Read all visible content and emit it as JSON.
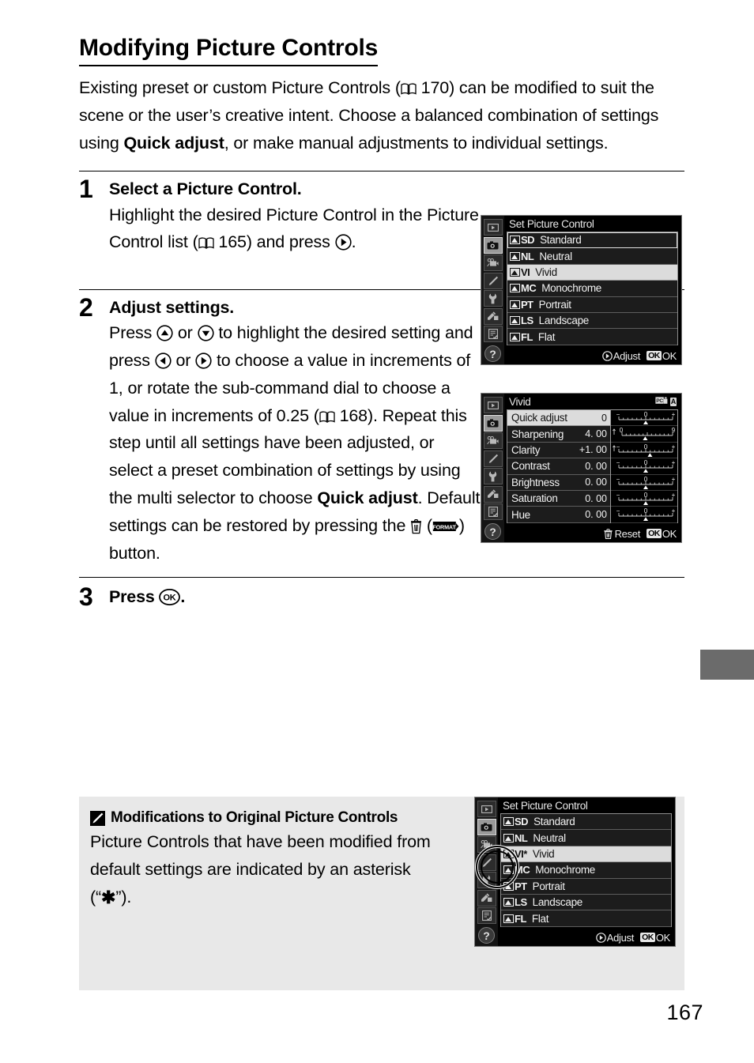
{
  "page": {
    "number": "167"
  },
  "heading": {
    "title": "Modifying Picture Controls"
  },
  "intro": {
    "p1_a": "Existing preset or custom Picture Controls (",
    "p1_ref": "170",
    "p1_b": ") can be modified to suit the scene or the user’s creative intent.  Choose a balanced combination of settings using ",
    "p1_bold": "Quick adjust",
    "p1_c": ", or make manual adjustments to individual settings."
  },
  "steps": [
    {
      "num": "1",
      "head": "Select a Picture Control.",
      "body_a": "Highlight the desired Picture Control in the Picture Control list (",
      "ref": "165",
      "body_b": ") and press ",
      "body_c": "."
    },
    {
      "num": "2",
      "head": "Adjust settings.",
      "body_a": "Press ",
      "body_b": " or ",
      "body_c": " to highlight the desired setting and press ",
      "body_d": " or ",
      "body_e": " to choose a value in increments of 1, or rotate the sub-command dial to choose a value in increments of 0.25 (",
      "ref": "168",
      "body_f": ").  Repeat this step until all settings have been adjusted, or select a preset combination of settings by using the multi selector to choose ",
      "bold": "Quick adjust",
      "body_g": ".  Default settings can be restored by pressing the ",
      "body_h": " (",
      "body_i": ") button."
    },
    {
      "num": "3",
      "head_a": "Press ",
      "head_b": "."
    }
  ],
  "note": {
    "icon": "pencil-icon",
    "title": "Modifications to Original Picture Controls",
    "body_a": "Picture Controls that have been modified from default settings are indicated by an asterisk (“",
    "asterisk": "✱",
    "body_b": "”)."
  },
  "lcd_rail": {
    "icons": [
      {
        "name": "playback-icon",
        "active": false
      },
      {
        "name": "photo-shooting-menu-icon",
        "active": true
      },
      {
        "name": "movie-shooting-menu-icon",
        "active": false
      },
      {
        "name": "custom-settings-pencil-icon",
        "active": false
      },
      {
        "name": "setup-wrench-icon",
        "active": false
      },
      {
        "name": "retouch-brush-icon",
        "active": false
      },
      {
        "name": "my-menu-icon",
        "active": false
      }
    ],
    "help_label": "?"
  },
  "screen1": {
    "title": "Set Picture Control",
    "rows": [
      {
        "code": "SD",
        "label": "Standard",
        "state": "cursor"
      },
      {
        "code": "NL",
        "label": "Neutral",
        "state": "normal"
      },
      {
        "code": "VI",
        "label": "Vivid",
        "state": "selected"
      },
      {
        "code": "MC",
        "label": "Monochrome",
        "state": "normal"
      },
      {
        "code": "PT",
        "label": "Portrait",
        "state": "normal"
      },
      {
        "code": "LS",
        "label": "Landscape",
        "state": "normal"
      },
      {
        "code": "FL",
        "label": "Flat",
        "state": "normal"
      }
    ],
    "hint_adjust": "Adjust",
    "hint_ok_pill": "OK",
    "hint_ok": "OK"
  },
  "screen2": {
    "title": "Vivid",
    "badge_icon": "auto-picture-control-icon",
    "badge_letter": "A",
    "rows": [
      {
        "label": "Quick adjust",
        "value": "0",
        "state": "selected",
        "slider": "plusminus",
        "marker": 0.5,
        "min_glyph": "−",
        "mid_glyph": "0",
        "max_glyph": "+"
      },
      {
        "label": "Sharpening",
        "value": "4. 00",
        "state": "normal",
        "slider": "zeronine",
        "marker": 0.46,
        "min_glyph": "0",
        "mid_glyph": "",
        "max_glyph": "9"
      },
      {
        "label": "Clarity",
        "value": "+1. 00",
        "state": "normal",
        "slider": "plusminus",
        "marker": 0.58,
        "min_glyph": "−",
        "mid_glyph": "0",
        "max_glyph": "+"
      },
      {
        "label": "Contrast",
        "value": "0. 00",
        "state": "normal",
        "slider": "plusminus",
        "marker": 0.5,
        "min_glyph": "−",
        "mid_glyph": "0",
        "max_glyph": "+"
      },
      {
        "label": "Brightness",
        "value": "0. 00",
        "state": "normal",
        "slider": "plusminus",
        "marker": 0.5,
        "min_glyph": "−",
        "mid_glyph": "0",
        "max_glyph": "+"
      },
      {
        "label": "Saturation",
        "value": "0. 00",
        "state": "normal",
        "slider": "plusminus",
        "marker": 0.5,
        "min_glyph": "−",
        "mid_glyph": "0",
        "max_glyph": "+"
      },
      {
        "label": "Hue",
        "value": "0. 00",
        "state": "normal",
        "slider": "plusminus",
        "marker": 0.5,
        "min_glyph": "−",
        "mid_glyph": "0",
        "max_glyph": "+"
      }
    ],
    "hint_reset": "Reset",
    "hint_ok_pill": "OK",
    "hint_ok": "OK"
  },
  "screen3": {
    "title": "Set Picture Control",
    "rows": [
      {
        "code": "SD",
        "label": "Standard",
        "state": "normal"
      },
      {
        "code": "NL",
        "label": "Neutral",
        "state": "normal"
      },
      {
        "code": "VI*",
        "label": "Vivid",
        "state": "selected"
      },
      {
        "code": "MC",
        "label": "Monochrome",
        "state": "normal"
      },
      {
        "code": "PT",
        "label": "Portrait",
        "state": "normal"
      },
      {
        "code": "LS",
        "label": "Landscape",
        "state": "normal"
      },
      {
        "code": "FL",
        "label": "Flat",
        "state": "normal"
      }
    ],
    "hint_adjust": "Adjust",
    "hint_ok_pill": "OK",
    "hint_ok": "OK",
    "callout": "modified-indicator-callout"
  }
}
